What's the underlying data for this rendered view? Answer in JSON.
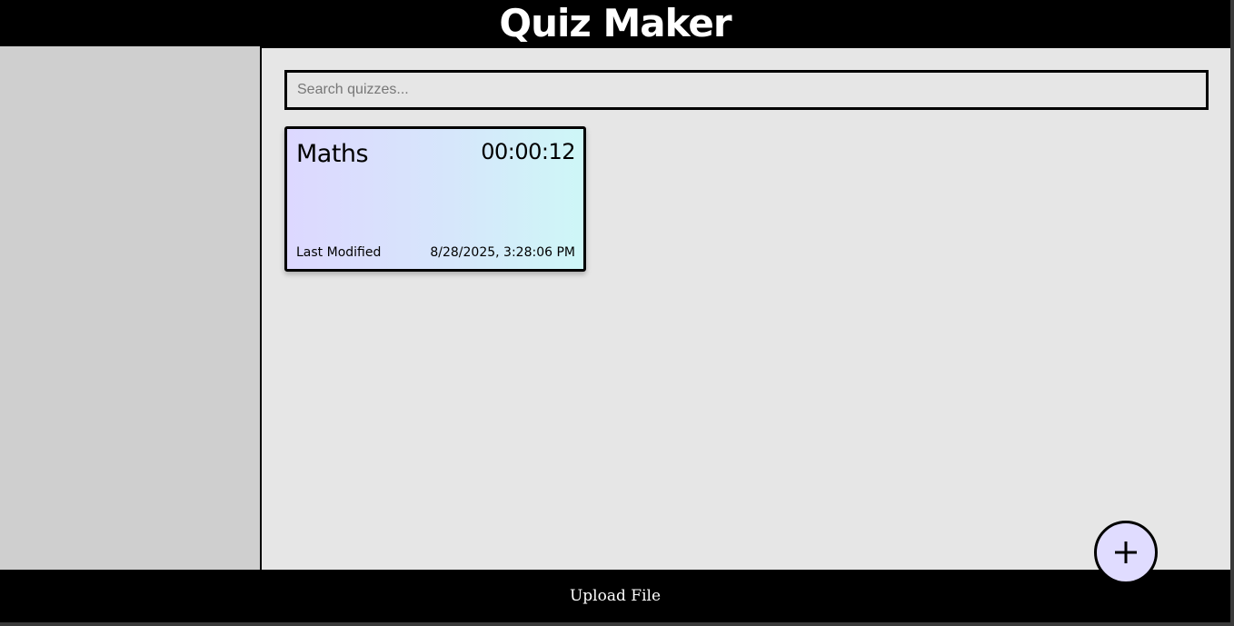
{
  "app": {
    "title": "Quiz Maker"
  },
  "search": {
    "placeholder": "Search quizzes...",
    "value": ""
  },
  "quizzes": [
    {
      "name": "Maths",
      "time": "00:00:12",
      "modified_label": "Last Modified",
      "modified_value": "8/28/2025, 3:28:06 PM"
    }
  ],
  "footer": {
    "upload_label": "Upload File"
  },
  "fab": {
    "icon": "plus-icon",
    "color": "#e0dcff"
  },
  "colors": {
    "header_bg": "#000000",
    "sidebar_bg": "#cfcfcf",
    "main_bg": "#e6e6e6",
    "card_gradient_start": "#ddd8ff",
    "card_gradient_end": "#cef7f7"
  }
}
